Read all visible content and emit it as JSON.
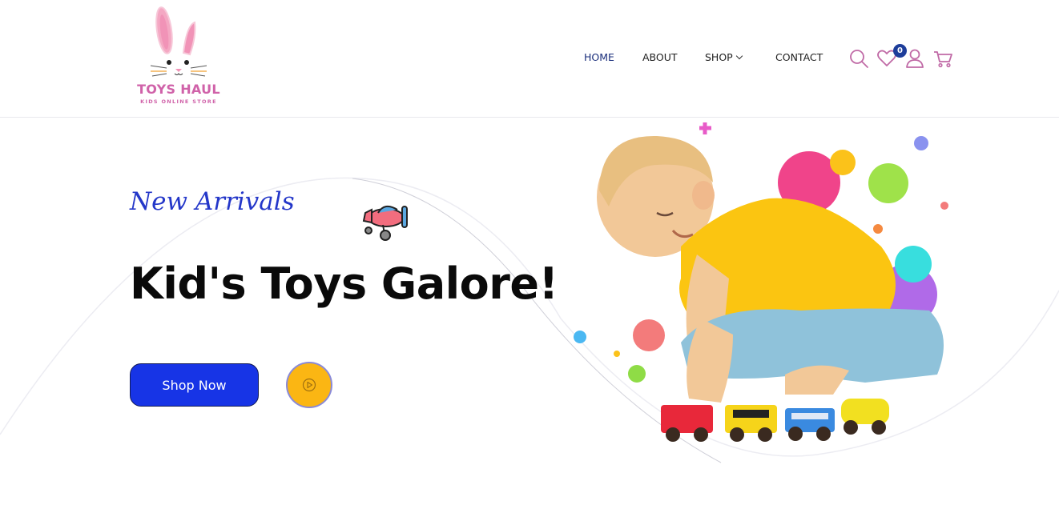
{
  "brand": {
    "name": "TOYS HAUL",
    "tagline": "KIDS ONLINE STORE",
    "color": "#d062a9"
  },
  "nav": {
    "items": [
      {
        "label": "HOME",
        "active": true
      },
      {
        "label": "ABOUT",
        "active": false
      },
      {
        "label": "SHOP",
        "active": false,
        "has_dropdown": true
      },
      {
        "label": "CONTACT",
        "active": false
      }
    ]
  },
  "header_icons": {
    "search": "search-icon",
    "wishlist": "heart-icon",
    "wishlist_count": "0",
    "account": "user-icon",
    "cart": "cart-icon",
    "icon_color": "#d062a9",
    "badge_color": "#1d3d9a"
  },
  "hero": {
    "subtitle": "New Arrivals",
    "title": "Kid's Toys Galore!",
    "cta_label": "Shop Now",
    "play_icon": "play-icon",
    "accent": "#1734e6",
    "play_color": "#fbb613"
  }
}
